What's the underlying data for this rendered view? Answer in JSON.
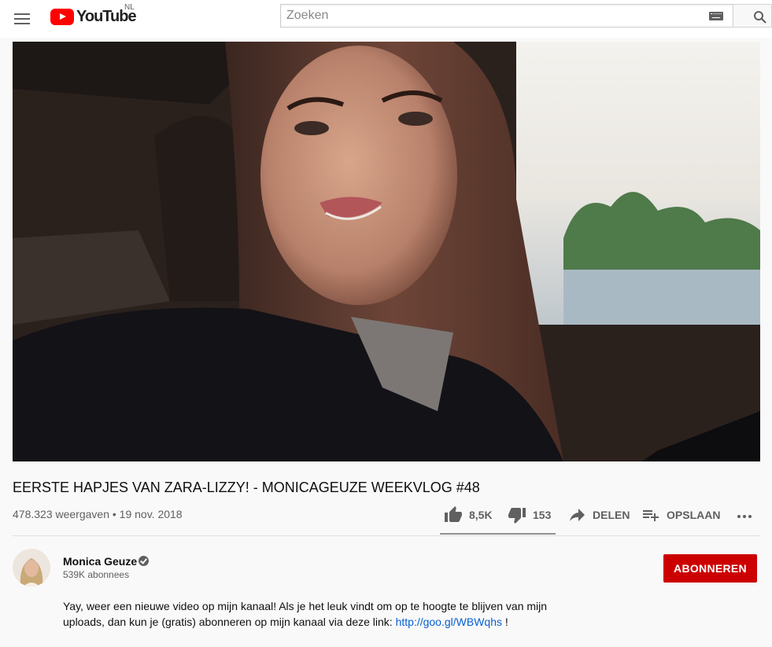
{
  "header": {
    "logo_text": "YouTube",
    "country_code": "NL",
    "search_placeholder": "Zoeken",
    "menu_icon": "hamburger-menu-icon",
    "keyboard_icon": "keyboard-icon",
    "search_icon": "magnifier-icon"
  },
  "video": {
    "title": "EERSTE HAPJES VAN ZARA-LIZZY! - MONICAGEUZE WEEKVLOG #48",
    "views_and_date": "478.323 weergaven • 19 nov. 2018",
    "like_count": "8,5K",
    "dislike_count": "153",
    "like_ratio": 0.982,
    "share_label": "DELEN",
    "save_label": "OPSLAAN"
  },
  "channel": {
    "name": "Monica Geuze",
    "subscribers": "539K abonnees",
    "subscribe_label": "ABONNEREN"
  },
  "description": {
    "text": "Yay, weer een nieuwe video op mijn kanaal! Als je het leuk vindt om op te hoogte te blijven van mijn uploads, dan kun je (gratis) abonneren op mijn kanaal via deze link: ",
    "link": "http://goo.gl/WBWqhs",
    "suffix": " !"
  },
  "colors": {
    "subscribe_red": "#cc0000",
    "link_blue": "#065fd4",
    "brand_red": "#ff0000"
  }
}
